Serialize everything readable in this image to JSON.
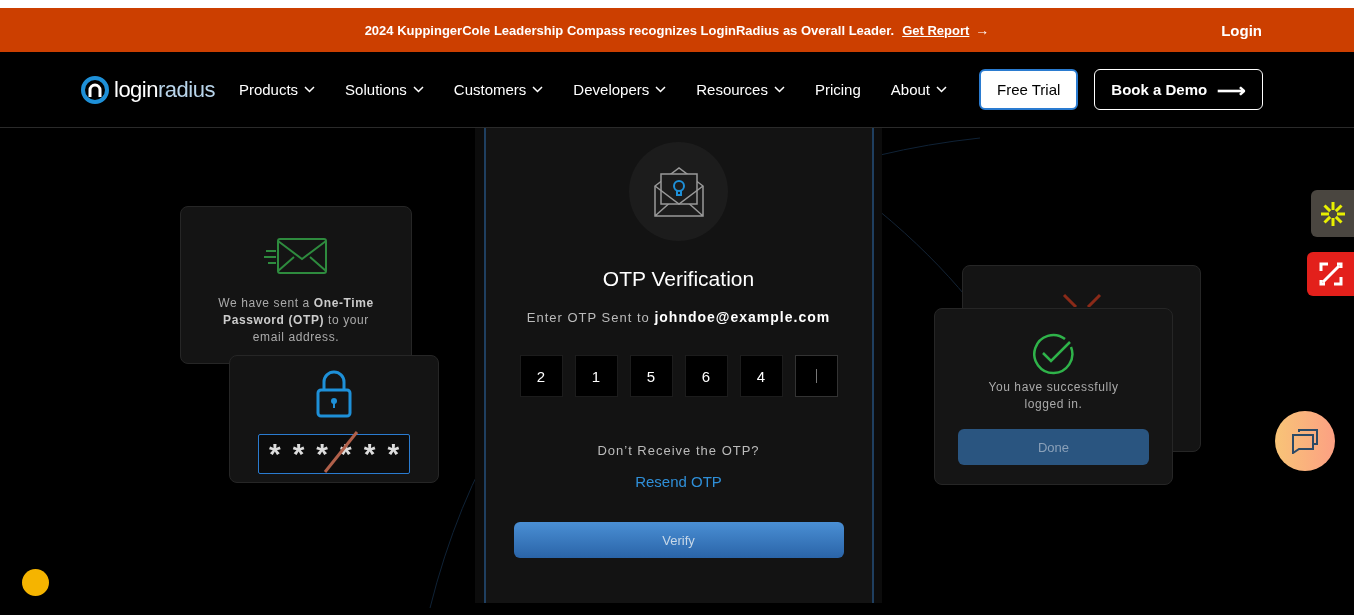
{
  "banner": {
    "text": "2024 KuppingerCole Leadership Compass recognizes LoginRadius as Overall Leader.",
    "link": "Get Report",
    "arrow": "→",
    "login": "Login"
  },
  "nav": {
    "logo": {
      "part_1": "login",
      "part_2": "radius"
    },
    "items": [
      {
        "label": "Products",
        "dropdown": true
      },
      {
        "label": "Solutions",
        "dropdown": true
      },
      {
        "label": "Customers",
        "dropdown": true
      },
      {
        "label": "Developers",
        "dropdown": true
      },
      {
        "label": "Resources",
        "dropdown": true
      },
      {
        "label": "Pricing",
        "dropdown": false
      },
      {
        "label": "About",
        "dropdown": true
      }
    ],
    "buttons": [
      {
        "label": "Free Trial",
        "kind": "solid"
      },
      {
        "label": "Book a Demo",
        "kind": "outline",
        "arrow": "⟶"
      }
    ]
  },
  "illustration": {
    "email_card": {
      "text": "We have sent a **One-Time Password (OTP)** to your email address."
    },
    "password_card": {
      "masked": [
        "*",
        "*",
        "*",
        "*",
        "*",
        "*"
      ]
    },
    "otp_card": {
      "title": "OTP Verification",
      "instruction": "Enter OTP Sent to **johndoe@example.com**",
      "boxes": [
        {
          "value": "2",
          "focused": false
        },
        {
          "value": "1",
          "focused": false
        },
        {
          "value": "5",
          "focused": false
        },
        {
          "value": "6",
          "focused": false
        },
        {
          "value": "4",
          "focused": false
        },
        {
          "focused": true
        }
      ],
      "resend_prompt": "Don’t Receive the OTP?",
      "resend_link": "Resend OTP",
      "verify_button": "Verify"
    },
    "success_card": {
      "text": "You have successfully logged in.",
      "done_button": "Done"
    }
  }
}
